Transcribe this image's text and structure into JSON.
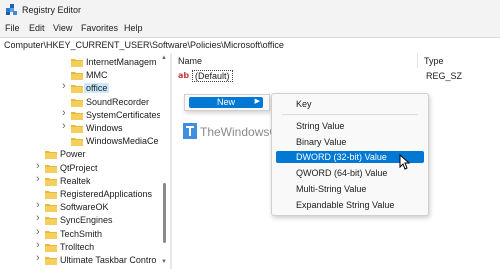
{
  "window": {
    "title": "Registry Editor"
  },
  "menubar": [
    "File",
    "Edit",
    "View",
    "Favorites",
    "Help"
  ],
  "address": "Computer\\HKEY_CURRENT_USER\\Software\\Policies\\Microsoft\\office",
  "tree": {
    "items": [
      {
        "label": "InternetManagem",
        "level": 2,
        "expandable": false,
        "selected": false
      },
      {
        "label": "MMC",
        "level": 2,
        "expandable": false,
        "selected": false
      },
      {
        "label": "office",
        "level": 2,
        "expandable": true,
        "selected": true
      },
      {
        "label": "SoundRecorder",
        "level": 2,
        "expandable": false,
        "selected": false
      },
      {
        "label": "SystemCertificates",
        "level": 2,
        "expandable": true,
        "selected": false
      },
      {
        "label": "Windows",
        "level": 2,
        "expandable": true,
        "selected": false
      },
      {
        "label": "WindowsMediaCe",
        "level": 2,
        "expandable": false,
        "selected": false
      },
      {
        "label": "Power",
        "level": 1,
        "expandable": false,
        "selected": false
      },
      {
        "label": "QtProject",
        "level": 1,
        "expandable": true,
        "selected": false
      },
      {
        "label": "Realtek",
        "level": 1,
        "expandable": true,
        "selected": false
      },
      {
        "label": "RegisteredApplications",
        "level": 1,
        "expandable": false,
        "selected": false
      },
      {
        "label": "SoftwareOK",
        "level": 1,
        "expandable": true,
        "selected": false
      },
      {
        "label": "SyncEngines",
        "level": 1,
        "expandable": true,
        "selected": false
      },
      {
        "label": "TechSmith",
        "level": 1,
        "expandable": true,
        "selected": false
      },
      {
        "label": "Trolltech",
        "level": 1,
        "expandable": true,
        "selected": false
      },
      {
        "label": "Ultimate Taskbar Contro",
        "level": 1,
        "expandable": true,
        "selected": false
      }
    ]
  },
  "values_pane": {
    "columns": {
      "name": "Name",
      "type": "Type"
    },
    "rows": [
      {
        "name": "(Default)",
        "type": "REG_SZ",
        "icon": "string-value-icon"
      }
    ]
  },
  "context_menu": {
    "new_label": "New"
  },
  "submenu": {
    "key": "Key",
    "items": [
      "String Value",
      "Binary Value",
      "DWORD (32-bit) Value",
      "QWORD (64-bit) Value",
      "Multi-String Value",
      "Expandable String Value"
    ],
    "highlighted": "DWORD (32-bit) Value"
  },
  "watermark": "TheWindowsClub",
  "colors": {
    "accent": "#0078d4",
    "folder": "#e8b838",
    "selection": "#cce8ff"
  }
}
